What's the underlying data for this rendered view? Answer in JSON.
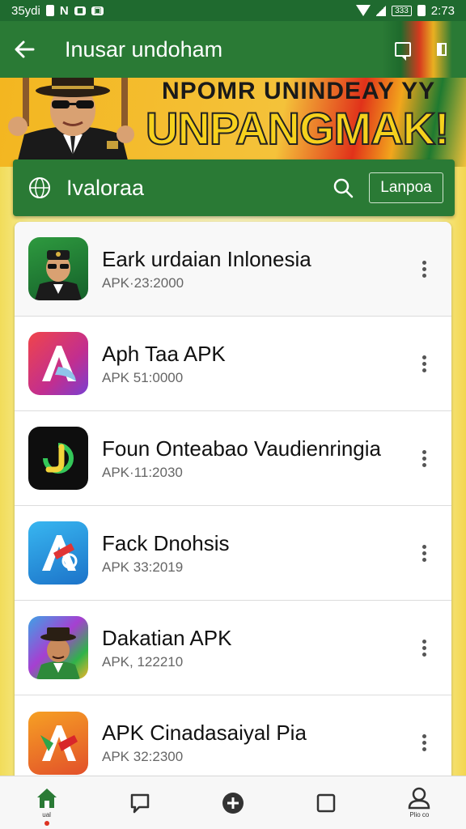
{
  "status_bar": {
    "left_text": "35ydi",
    "left_letter": "N",
    "badge": "333",
    "time": "2:73"
  },
  "app_bar": {
    "title": "Inusar undoham",
    "back_icon": "arrow-left-icon",
    "chat_icon": "chat-bubble-icon",
    "extra_icon": "square-icon"
  },
  "banner": {
    "line1": "NPOMR UNINDEAY YY",
    "line2": "UNPANGMAK!"
  },
  "search": {
    "label": "Ivaloraa",
    "button": "Lanpoa",
    "globe_icon": "globe-icon",
    "search_icon": "search-icon"
  },
  "apps": [
    {
      "title": "Eark urdaian Inlonesia",
      "subtitle": "APK·23:2000",
      "icon": "officer-avatar-icon"
    },
    {
      "title": "Aph Taa APK",
      "subtitle": "APK 51:0000",
      "icon": "letter-a-gradient-icon"
    },
    {
      "title": "Foun Onteabao Vaudienringia",
      "subtitle": "APK·11:2030",
      "icon": "letter-j-icon"
    },
    {
      "title": "Fack Dnohsis",
      "subtitle": "APK 33:2019",
      "icon": "letter-a-blue-icon"
    },
    {
      "title": "Dakatian APK",
      "subtitle": "APK, 122210",
      "icon": "man-hat-avatar-icon"
    },
    {
      "title": "APK Cinadasaiyal Pia",
      "subtitle": "APK 32:2300",
      "icon": "letter-a-orange-icon"
    }
  ],
  "bottom_nav": [
    {
      "icon": "home-icon",
      "label": "ual"
    },
    {
      "icon": "chat-icon",
      "label": ""
    },
    {
      "icon": "add-circle-icon",
      "label": ""
    },
    {
      "icon": "square-icon",
      "label": ""
    },
    {
      "icon": "profile-icon",
      "label": "Plio co"
    }
  ],
  "colors": {
    "primary_green": "#2a7a35",
    "status_green": "#1f6a2f",
    "banner_yellow": "#f3b620"
  }
}
